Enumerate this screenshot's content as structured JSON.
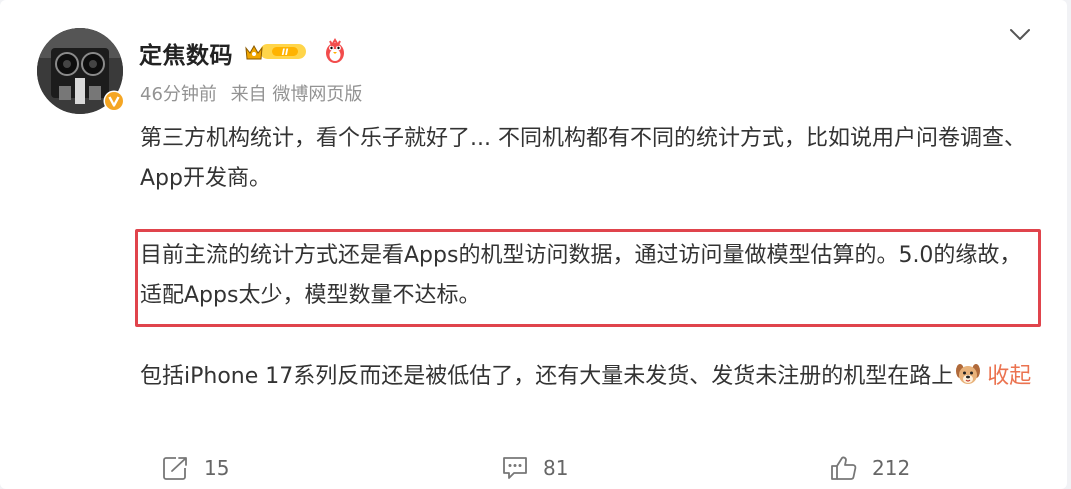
{
  "post": {
    "username": "定焦数码",
    "meta": {
      "time": "46分钟前",
      "source": "来自 微博网页版"
    },
    "paragraphs": {
      "p1": "第三方机构统计，看个乐子就好了... 不同机构都有不同的统计方式，比如说用户问卷调查、App开发商。",
      "p2": "目前主流的统计方式还是看Apps的机型访问数据，通过访问量做模型估算的。5.0的缘故，适配Apps太少，模型数量不达标。",
      "p3": "包括iPhone 17系列反而还是被低估了，还有大量未发货、发货未注册的机型在路上"
    },
    "collapse_label": "收起",
    "badges": {
      "vip_level": "II"
    }
  },
  "actions": {
    "repost_count": "15",
    "comment_count": "81",
    "like_count": "212"
  },
  "colors": {
    "highlight_border": "#e0444c",
    "link": "#eb7350",
    "meta": "#939393",
    "verified": "#f5a623"
  },
  "icons": {
    "more": "chevron-down-icon",
    "repost": "repost-icon",
    "comment": "comment-icon",
    "like": "thumbs-up-icon",
    "verified": "verified-v-icon",
    "vip": "crown-badge-icon",
    "mascot": "mascot-icon",
    "emoji": "dog-face-emoji-icon"
  }
}
